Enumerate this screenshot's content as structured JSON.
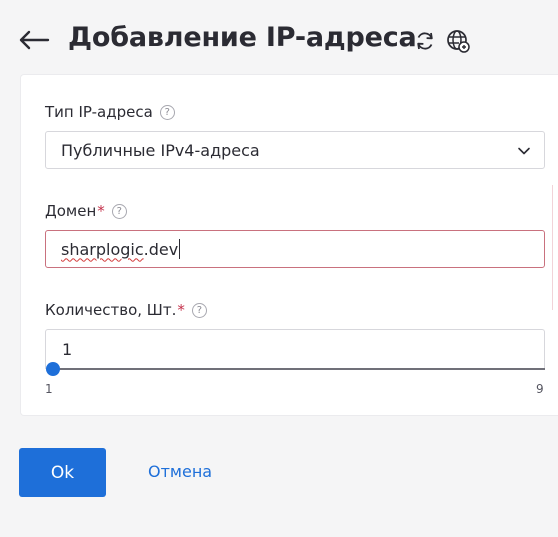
{
  "header": {
    "title": "Добавление IP-адреса",
    "icons": [
      "back-arrow-icon",
      "refresh-icon",
      "globe-icon"
    ]
  },
  "form": {
    "ip_type": {
      "label": "Тип IP-адреса",
      "help": "?",
      "value": "Публичные IPv4-адреса"
    },
    "domain": {
      "label": "Домен",
      "required_mark": "*",
      "help": "?",
      "value_spellchecked": "sharplogic",
      "value_rest": ".dev"
    },
    "quantity": {
      "label": "Количество, Шт.",
      "required_mark": "*",
      "help": "?",
      "value": "1",
      "slider_min": "1",
      "slider_max": "9",
      "slider_value": 1
    }
  },
  "actions": {
    "ok_label": "Ok",
    "cancel_label": "Отмена"
  },
  "colors": {
    "accent": "#1e6fd9",
    "required": "#c4314b",
    "background": "#f5f5f6"
  }
}
